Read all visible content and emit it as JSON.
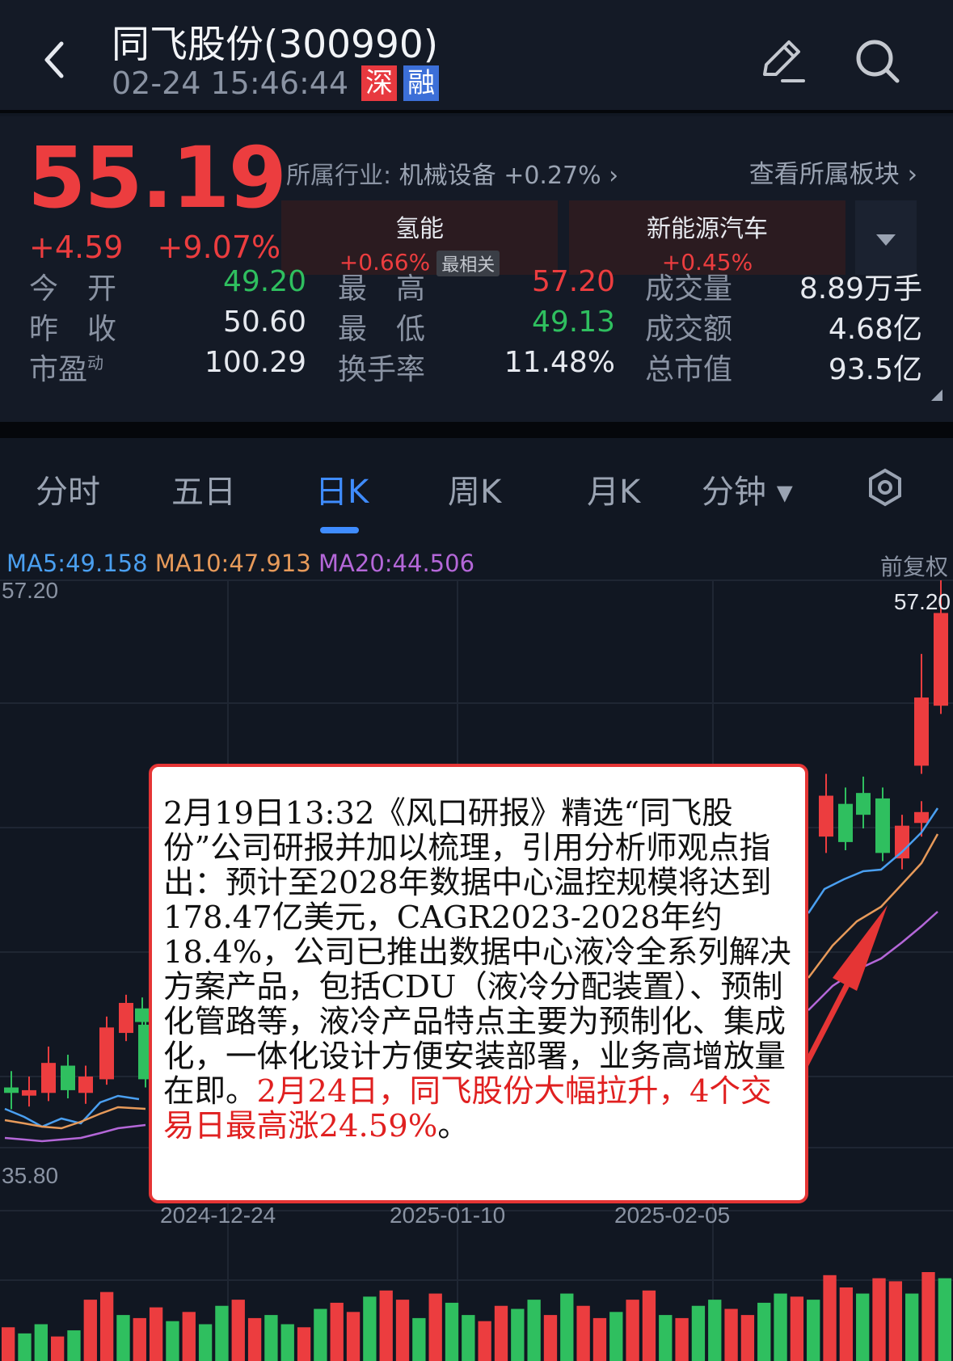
{
  "header": {
    "title": "同飞股份(300990)",
    "datetime": "02-24 15:46:44",
    "badge_sz": "深",
    "badge_rong": "融"
  },
  "quote": {
    "price": "55.19",
    "change": "+4.59",
    "change_pct": "+9.07%",
    "industry_label": "所属行业:",
    "industry_value": "机械设备 +0.27% ›",
    "view_plates": "查看所属板块 ›",
    "plates": [
      {
        "name": "氢能",
        "change": "+0.66%",
        "tag": "最相关"
      },
      {
        "name": "新能源汽车",
        "change": "+0.45%"
      }
    ],
    "rows": [
      {
        "l1": "今　开",
        "v1": "49.20",
        "l2": "最　高",
        "v2": "57.20",
        "l3": "成交量",
        "v3": "8.89万手"
      },
      {
        "l1": "昨　收",
        "v1": "50.60",
        "l2": "最　低",
        "v2": "49.13",
        "l3": "成交额",
        "v3": "4.68亿"
      },
      {
        "l1": "市盈",
        "l1_sup": "动",
        "v1": "100.29",
        "l2": "换手率",
        "v2": "11.48%",
        "l3": "总市值",
        "v3": "93.5亿"
      }
    ]
  },
  "tabs": [
    "分时",
    "五日",
    "日K",
    "周K",
    "月K",
    "分钟 ▾"
  ],
  "chart": {
    "ma5": "MA5:49.158",
    "ma10": "MA10:47.913",
    "ma20": "MA20:44.506",
    "adjust": "前复权",
    "high_left": "57.20",
    "high_right": "57.20",
    "low_left": "35.80",
    "dates": [
      "2024-12-24",
      "2025-01-10",
      "2025-02-05"
    ],
    "colors": {
      "up": "#ec3d3f",
      "down": "#2fbf5f",
      "ma5": "#4a9ff0",
      "ma10": "#e79a5a",
      "ma20": "#b467d8"
    }
  },
  "chart_data": {
    "type": "candlestick",
    "ylim": [
      35.8,
      57.2
    ],
    "candles": [
      {
        "o": 38.6,
        "c": 38.4,
        "h": 39.2,
        "l": 37.8
      },
      {
        "o": 38.3,
        "c": 38.5,
        "h": 39.0,
        "l": 37.9
      },
      {
        "o": 38.4,
        "c": 39.5,
        "h": 40.1,
        "l": 38.1
      },
      {
        "o": 39.4,
        "c": 38.5,
        "h": 39.8,
        "l": 38.2
      },
      {
        "o": 38.4,
        "c": 39.0,
        "h": 39.4,
        "l": 38.0
      },
      {
        "o": 38.9,
        "c": 40.8,
        "h": 41.2,
        "l": 38.7
      },
      {
        "o": 40.6,
        "c": 41.7,
        "h": 42.0,
        "l": 40.3
      },
      {
        "o": 41.5,
        "c": 41.0,
        "h": 41.9,
        "l": 40.7
      },
      {
        "o": 40.9,
        "c": 38.9,
        "h": 41.3,
        "l": 38.6
      },
      {
        "o": 47.8,
        "c": 49.3,
        "h": 50.1,
        "l": 47.2
      },
      {
        "o": 49.0,
        "c": 47.6,
        "h": 49.6,
        "l": 47.3
      },
      {
        "o": 49.4,
        "c": 48.6,
        "h": 50.0,
        "l": 48.1
      },
      {
        "o": 49.2,
        "c": 47.2,
        "h": 49.6,
        "l": 46.9
      },
      {
        "o": 47.0,
        "c": 48.2,
        "h": 48.6,
        "l": 46.6
      },
      {
        "o": 48.3,
        "c": 48.7,
        "h": 49.1,
        "l": 47.8
      },
      {
        "o": 50.4,
        "c": 52.9,
        "h": 54.5,
        "l": 50.1
      },
      {
        "o": 52.6,
        "c": 56.0,
        "h": 57.2,
        "l": 52.3
      }
    ],
    "volumes": [
      22,
      18,
      24,
      16,
      20,
      40,
      45,
      30,
      28,
      35,
      26,
      32,
      24,
      36,
      40,
      28,
      30,
      24,
      22,
      34,
      38,
      32,
      42,
      46,
      40,
      28,
      44,
      38,
      30,
      26,
      36,
      34,
      40,
      30,
      44,
      36,
      28,
      32,
      40,
      46,
      30,
      28,
      36,
      40,
      34,
      30,
      38,
      44,
      42,
      40,
      56,
      48,
      44,
      54,
      52,
      44,
      58,
      54
    ]
  },
  "note": {
    "black": "2月19日13:32《风口研报》精选“同飞股份”公司研报并加以梳理，引用分析师观点指出：预计至2028年数据中心温控规模将达到178.47亿美元，CAGR2023-2028年约18.4%，公司已推出数据中心液冷全系列解决方案产品，包括CDU（液冷分配装置）、预制化管路等，液冷产品特点主要为预制化、集成化，一体化设计方便安装部署，业务高增放量在即。",
    "red": "2月24日，同飞股份大幅拉升，4个交易日最高涨24.59%",
    "end": "。"
  }
}
